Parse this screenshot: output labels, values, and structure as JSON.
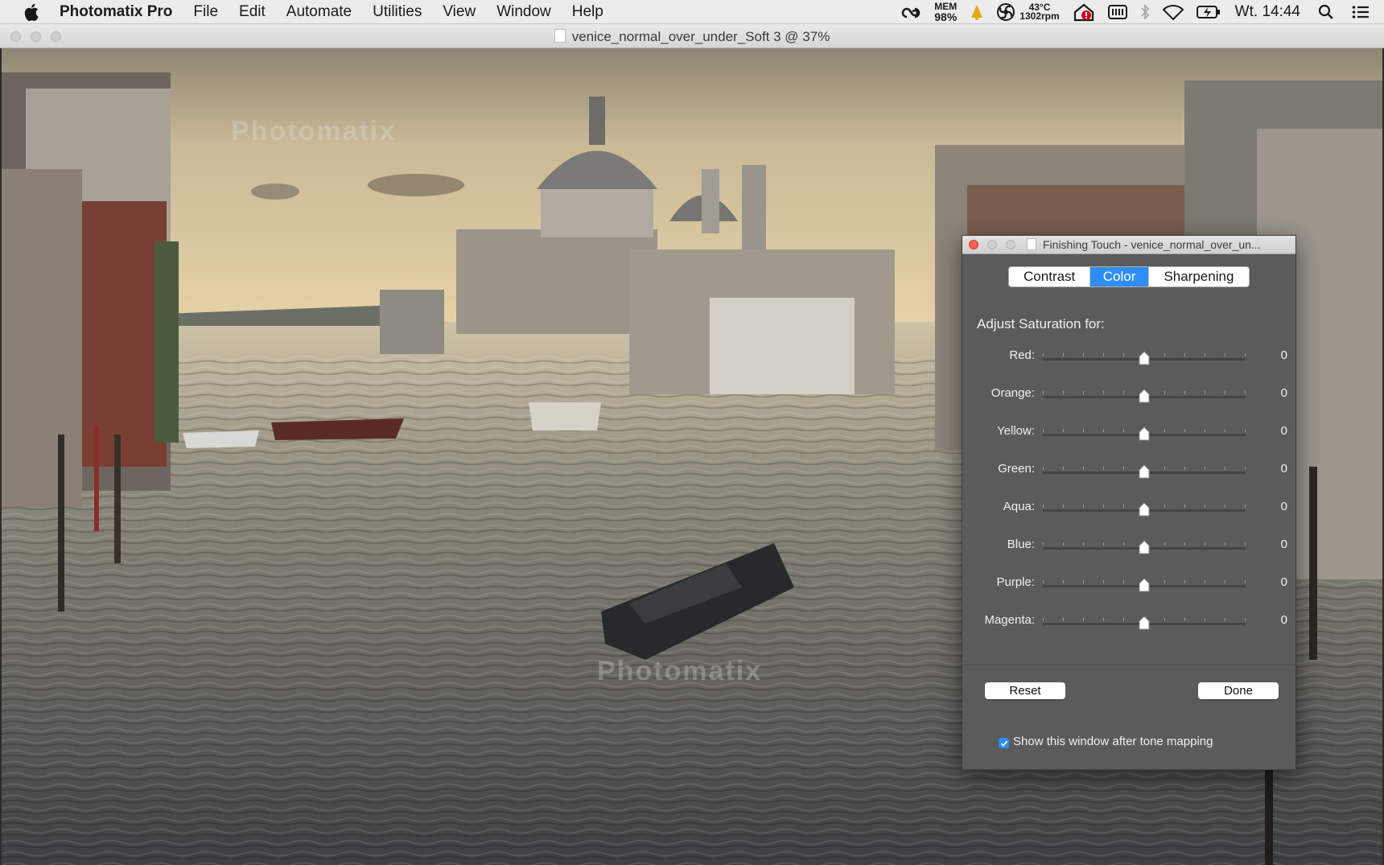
{
  "menubar": {
    "app_name": "Photomatix Pro",
    "items": [
      "File",
      "Edit",
      "Automate",
      "Utilities",
      "View",
      "Window",
      "Help"
    ],
    "status": {
      "mem_label": "MEM",
      "mem_value": "98%",
      "temp": "43°C",
      "fan": "1302rpm",
      "clock": "Wt. 14:44"
    }
  },
  "document": {
    "title": "venice_normal_over_under_Soft 3 @ 37%",
    "watermarks": [
      "Photomatix",
      "Photomatix"
    ]
  },
  "dialog": {
    "title": "Finishing Touch - venice_normal_over_un...",
    "tabs": [
      {
        "label": "Contrast",
        "active": false
      },
      {
        "label": "Color",
        "active": true
      },
      {
        "label": "Sharpening",
        "active": false
      }
    ],
    "heading": "Adjust Saturation for:",
    "sliders": [
      {
        "label": "Red:",
        "value": "0",
        "level": 0.5
      },
      {
        "label": "Orange:",
        "value": "0",
        "level": 0.5
      },
      {
        "label": "Yellow:",
        "value": "0",
        "level": 0.5
      },
      {
        "label": "Green:",
        "value": "0",
        "level": 0.5
      },
      {
        "label": "Aqua:",
        "value": "0",
        "level": 0.5
      },
      {
        "label": "Blue:",
        "value": "0",
        "level": 0.5
      },
      {
        "label": "Purple:",
        "value": "0",
        "level": 0.5
      },
      {
        "label": "Magenta:",
        "value": "0",
        "level": 0.5
      }
    ],
    "reset_label": "Reset",
    "done_label": "Done",
    "show_after_label": "Show this window after tone mapping",
    "show_after_checked": true
  },
  "colors": {
    "accent": "#2e8ef6",
    "dialog_bg": "#5b5b5b",
    "close_red": "#fc5f57"
  }
}
